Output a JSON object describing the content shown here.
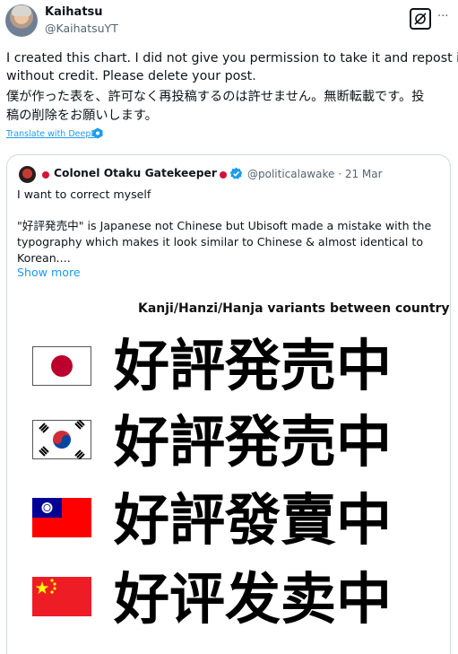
{
  "author": {
    "name": "Kaihatsu",
    "handle": "@KaihatsuYT"
  },
  "header_icons": [
    "grok-icon",
    "more-options-icon"
  ],
  "more_label": "···",
  "post": {
    "lines": [
      "I created this chart. I did not give you permission to take it and repost it",
      "without credit. Please delete your post.",
      "僕が作った表を、許可なく再投稿するのは許せません。無断転載です。投",
      "稿の削除をお願いします。"
    ],
    "translate_link": "Translate with DeepL"
  },
  "quote": {
    "name": "Colonel Otaku Gatekeeper",
    "handle_date": "@politicalawake · 21 Mar",
    "lines": [
      "I want to correct myself",
      "\"好評発売中\" is Japanese not Chinese but  Ubisoft made a mistake with the",
      "typography which makes it look similar to Chinese & almost identical to",
      "Korean...."
    ],
    "show_more": "Show more"
  },
  "chart_image": {
    "title": "Kanji/Hanzi/Hanja variants between country",
    "rows": [
      {
        "flag": "japan-flag-icon",
        "chars": "好評発売中"
      },
      {
        "flag": "south-korea-flag-icon",
        "chars": "好評発売中"
      },
      {
        "flag": "taiwan-flag-icon",
        "chars": "好評發賣中"
      },
      {
        "flag": "china-flag-icon",
        "chars": "好评发卖中"
      }
    ]
  },
  "colors": {
    "link": "#1d9bf0",
    "secondary_text": "#536471",
    "border": "#cfd9de",
    "verified": "#1d9bf0"
  }
}
